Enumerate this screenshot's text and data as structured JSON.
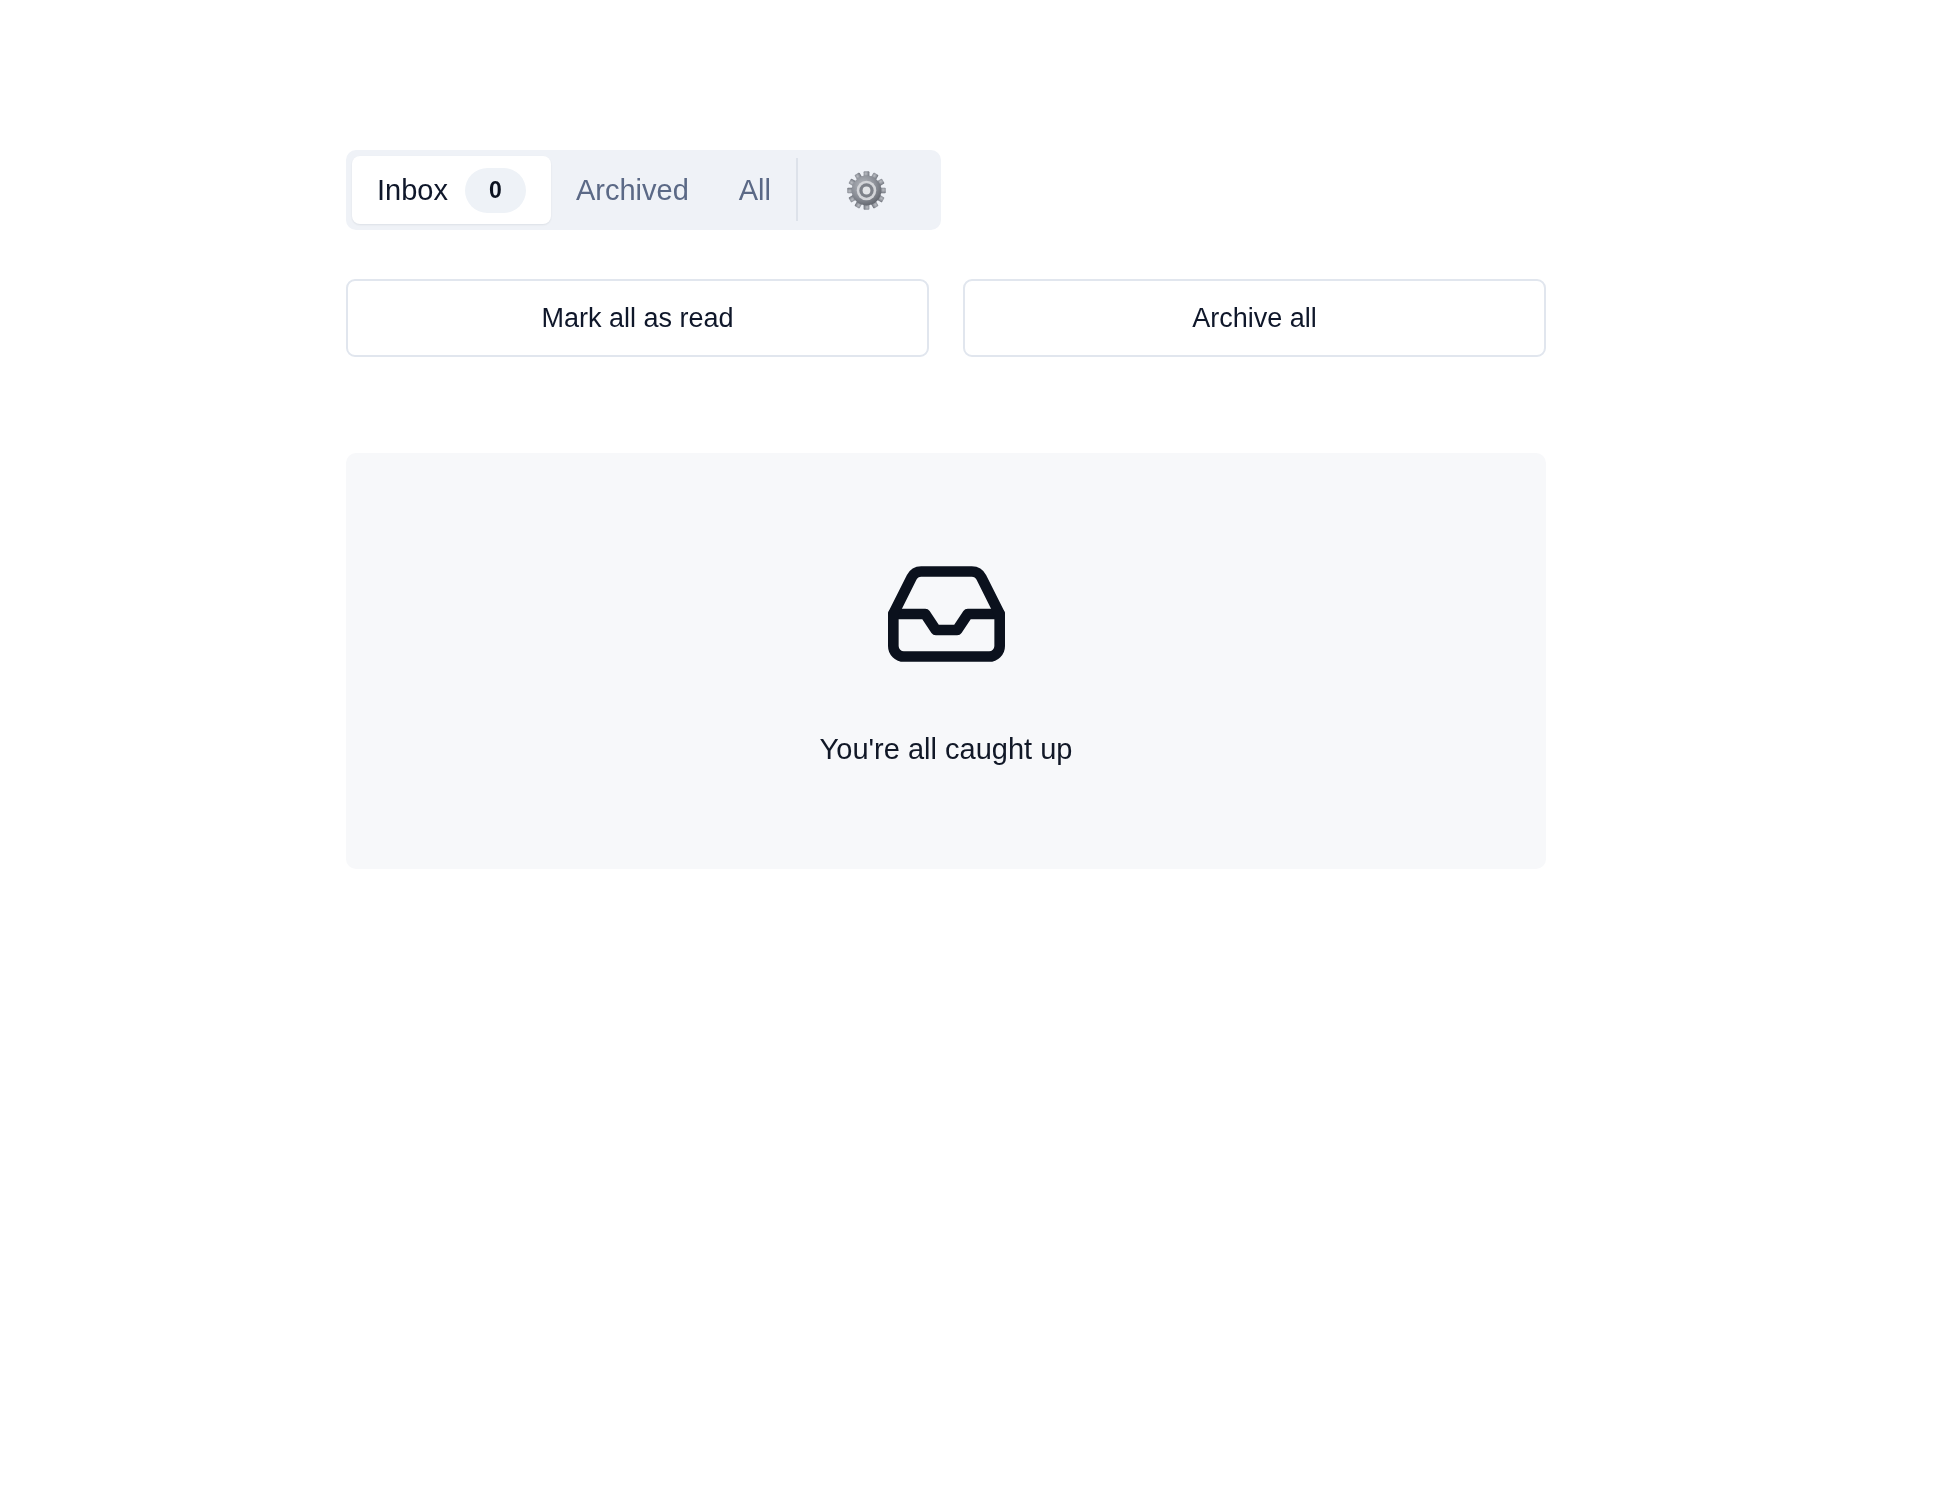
{
  "tabs": [
    {
      "label": "Inbox",
      "selected": true,
      "count": "0"
    },
    {
      "label": "Archived",
      "selected": false
    },
    {
      "label": "All",
      "selected": false
    }
  ],
  "actions": [
    "Mark all as read",
    "Archive all"
  ],
  "empty_state": {
    "message": "You're all caught up"
  }
}
